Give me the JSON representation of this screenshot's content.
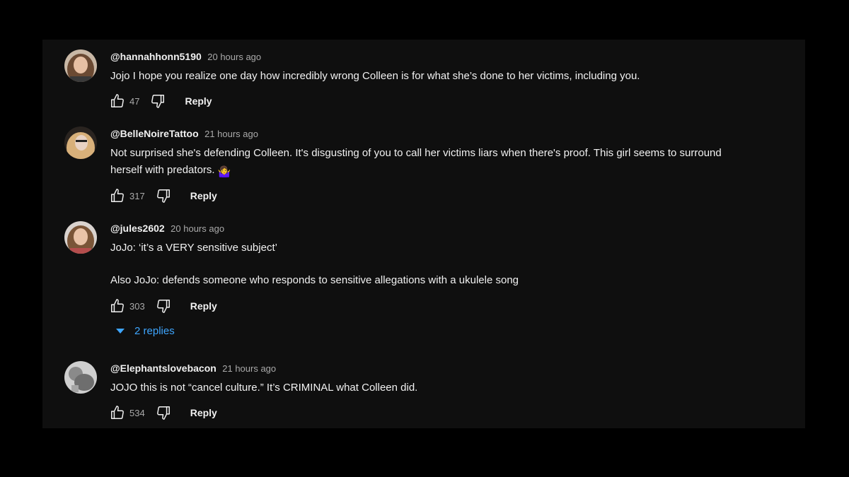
{
  "colors": {
    "background": "#000000",
    "panel": "#0f0f0f",
    "text": "#f1f1f1",
    "muted": "#aaaaaa",
    "link": "#3ea6ff"
  },
  "icons": {
    "like": "thumbs-up-icon",
    "dislike": "thumbs-down-icon",
    "expand": "caret-down-icon"
  },
  "comments": [
    {
      "handle": "@hannahhonn5190",
      "time": "20 hours ago",
      "text_lines": [
        "Jojo I hope you realize one day how incredibly wrong Colleen is for what she’s done to her victims, including you."
      ],
      "likes": "47",
      "reply_label": "Reply"
    },
    {
      "handle": "@BelleNoireTattoo",
      "time": "21 hours ago",
      "text_lines": [
        "Not surprised she's defending Colleen. It's disgusting of you to call her victims liars when there's proof. This girl seems to surround",
        "herself with predators."
      ],
      "emoji": "🤷‍♀️",
      "likes": "317",
      "reply_label": "Reply"
    },
    {
      "handle": "@jules2602",
      "time": "20 hours ago",
      "text_lines": [
        "JoJo: ‘it’s a VERY sensitive subject’",
        "Also JoJo: defends someone who responds to sensitive allegations with a ukulele song"
      ],
      "likes": "303",
      "reply_label": "Reply",
      "replies_label": "2 replies"
    },
    {
      "handle": "@Elephantslovebacon",
      "time": "21 hours ago",
      "text_lines": [
        "JOJO this is not “cancel culture.” It’s CRIMINAL what Colleen did."
      ],
      "likes": "534",
      "reply_label": "Reply"
    }
  ]
}
